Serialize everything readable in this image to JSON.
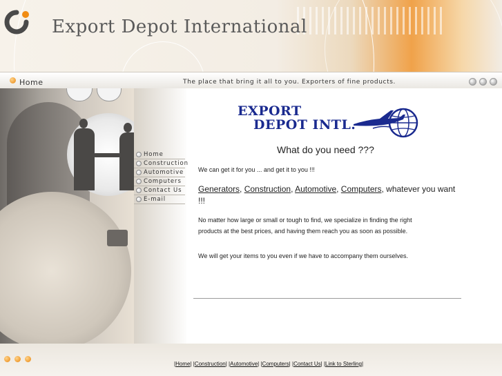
{
  "header": {
    "site_title": "Export Depot International"
  },
  "topbar": {
    "home_tab": "Home",
    "tagline": "The place that bring it all to you. Exporters of fine products."
  },
  "nav": {
    "items": [
      {
        "label": "Home"
      },
      {
        "label": "Construction"
      },
      {
        "label": "Automotive"
      },
      {
        "label": "Computers"
      },
      {
        "label": "Contact Us"
      },
      {
        "label": "E-mail"
      }
    ]
  },
  "main": {
    "brand_line1": "EXPORT",
    "brand_line2": "DEPOT INTL.",
    "headline": "What do you need ???",
    "intro": "We can get it for you ... and get it to you !!!",
    "product_links": [
      "Generators",
      "Construction",
      "Automotive",
      "Computers"
    ],
    "product_suffix": ", whatever you want !!!",
    "para1": "No matter how large or small or tough to find, we specialize in finding the right products at the best prices, and having them reach you as soon as possible.",
    "para2": "We will get your items to you even if we have to accompany them ourselves."
  },
  "footer": {
    "links": [
      "Home",
      "Construction",
      "Automotive",
      "Computers",
      "Contact Us",
      "Link to Sterling"
    ]
  },
  "colors": {
    "accent_orange": "#e8860f",
    "brand_blue": "#1a2a8f"
  }
}
